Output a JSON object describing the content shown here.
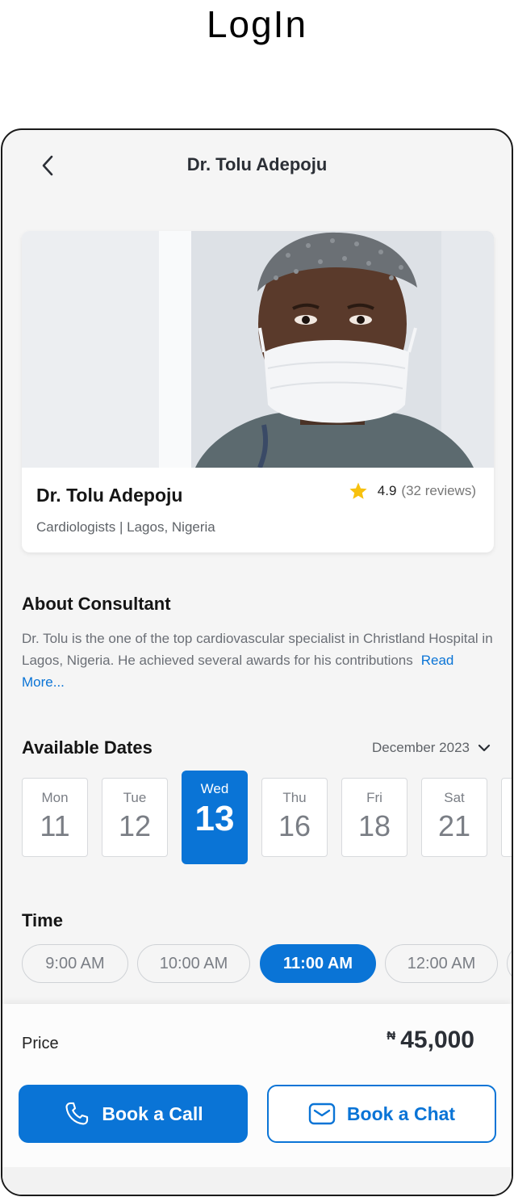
{
  "page": {
    "heading": "LogIn"
  },
  "header": {
    "title": "Dr. Tolu Adepoju",
    "back_icon": "chevron-left-icon"
  },
  "profile": {
    "name": "Dr. Tolu Adepoju",
    "specialty_location": "Cardiologists | Lagos, Nigeria",
    "rating": "4.9",
    "reviews": "(32 reviews)",
    "star_color": "#f7c10f"
  },
  "about": {
    "title": "About Consultant",
    "text": "Dr. Tolu is the one of the top cardiovascular specialist in Christland Hospital in Lagos, Nigeria. He achieved several awards for his contributions",
    "read_more": "Read More..."
  },
  "dates": {
    "title": "Available Dates",
    "month": "December 2023",
    "items": [
      {
        "day": "Mon",
        "num": "11"
      },
      {
        "day": "Tue",
        "num": "12"
      },
      {
        "day": "Wed",
        "num": "13"
      },
      {
        "day": "Thu",
        "num": "16"
      },
      {
        "day": "Fri",
        "num": "18"
      },
      {
        "day": "Sat",
        "num": "21"
      }
    ],
    "selected": "Wed"
  },
  "time": {
    "title": "Time",
    "slots": [
      "9:00 AM",
      "10:00 AM",
      "11:00 AM",
      "12:00 AM"
    ],
    "selected": "11:00 AM"
  },
  "footer": {
    "price_label": "Price",
    "currency": "₦",
    "price": "45,000",
    "call_button": "Book a Call",
    "chat_button": "Book a Chat"
  },
  "colors": {
    "accent": "#0a74d6",
    "background": "#f5f5f5"
  }
}
